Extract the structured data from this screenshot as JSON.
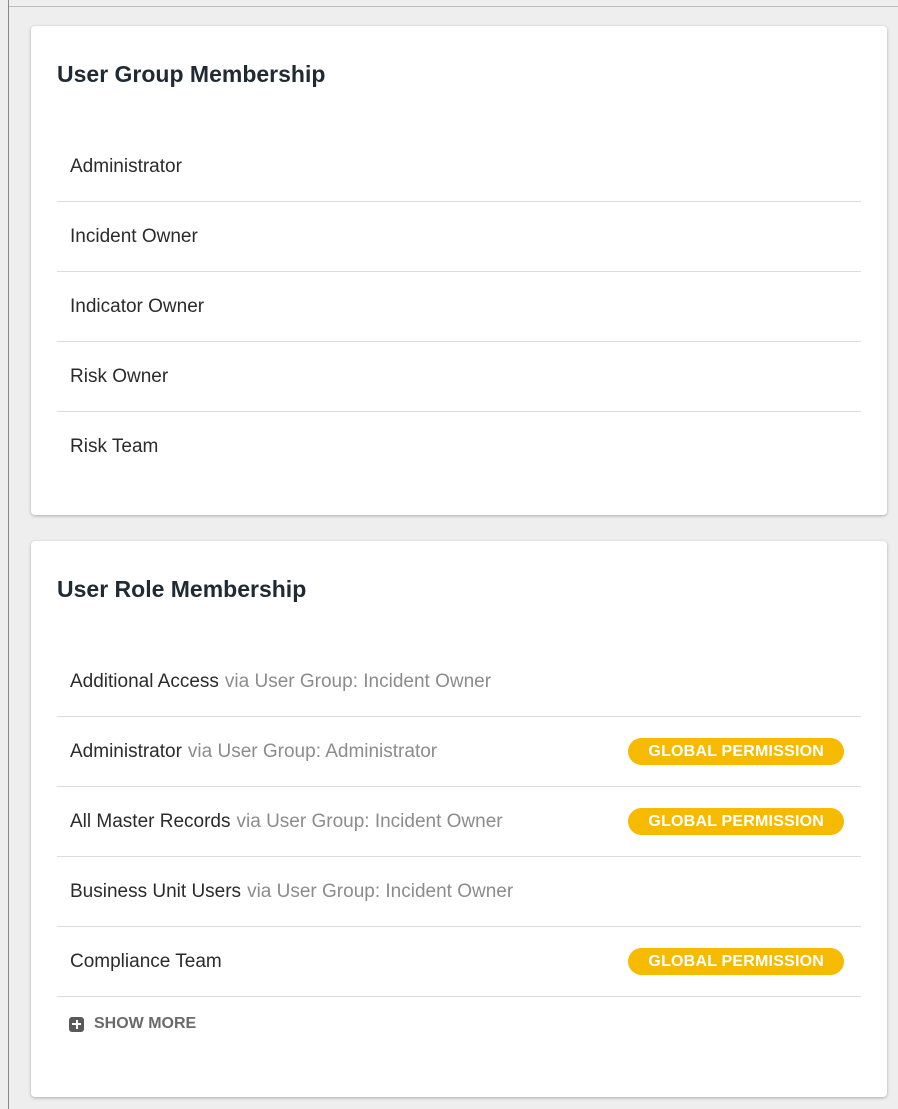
{
  "user_groups": {
    "title": "User Group Membership",
    "items": [
      {
        "name": "Administrator"
      },
      {
        "name": "Incident Owner"
      },
      {
        "name": "Indicator Owner"
      },
      {
        "name": "Risk Owner"
      },
      {
        "name": "Risk Team"
      }
    ]
  },
  "user_roles": {
    "title": "User Role Membership",
    "badge_color": "#f6bb00",
    "items": [
      {
        "name": "Additional Access",
        "via": "via User Group: Incident Owner",
        "badge": ""
      },
      {
        "name": "Administrator",
        "via": "via User Group: Administrator",
        "badge": "GLOBAL PERMISSION"
      },
      {
        "name": "All Master Records",
        "via": "via User Group: Incident Owner",
        "badge": "GLOBAL PERMISSION"
      },
      {
        "name": "Business Unit Users",
        "via": "via User Group: Incident Owner",
        "badge": ""
      },
      {
        "name": "Compliance Team",
        "via": "",
        "badge": "GLOBAL PERMISSION"
      }
    ],
    "show_more_label": "SHOW MORE",
    "show_more_icon": "plus-square-icon"
  }
}
